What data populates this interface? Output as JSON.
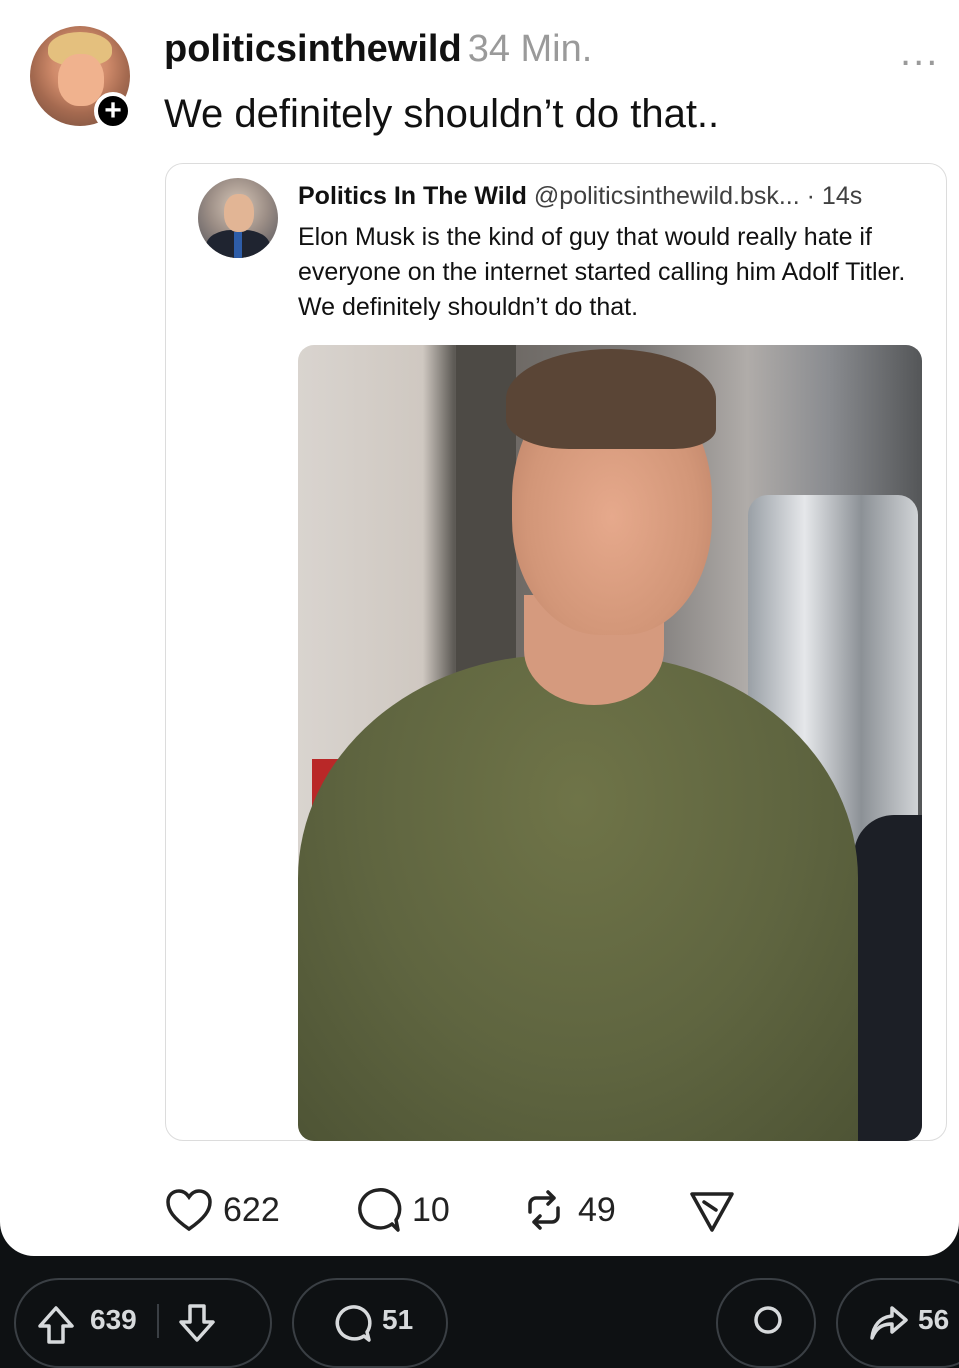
{
  "post": {
    "username": "politicsinthewild",
    "time": "34 Min.",
    "text": "We definitely shouldn’t do that..",
    "more": "..."
  },
  "embed": {
    "author": "Politics In The Wild",
    "handle": "@politicsinthewild.bsk...",
    "time": "· 14s",
    "text": "Elon Musk is the kind of guy that would really hate if everyone on the internet started calling him Adolf Titler. We definitely shouldn’t do that."
  },
  "actions": {
    "likes": "622",
    "replies": "10",
    "reposts": "49"
  },
  "bottom_bar": {
    "upvotes": "639",
    "comments": "51",
    "shares": "56"
  },
  "icons": [
    "plus-icon",
    "more-icon",
    "heart-icon",
    "reply-icon",
    "repost-icon",
    "send-icon",
    "upvote-icon",
    "downvote-icon",
    "comment-icon",
    "award-icon",
    "share-icon"
  ]
}
